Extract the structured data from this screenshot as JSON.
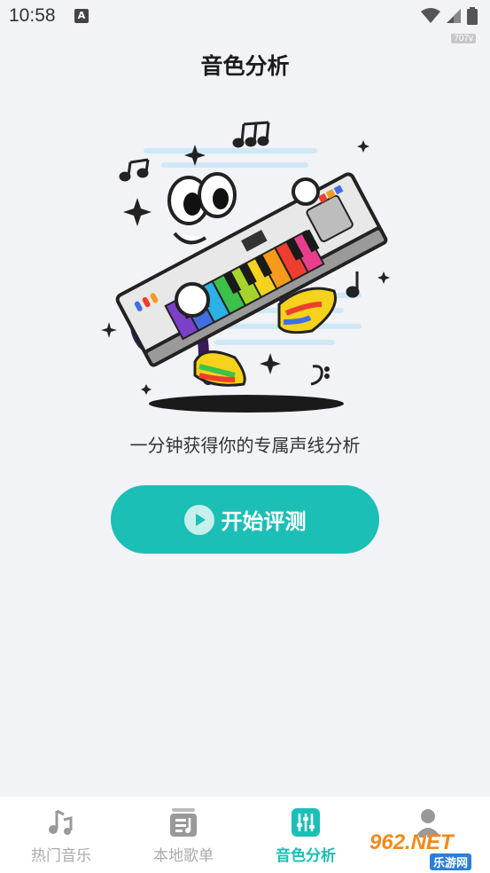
{
  "status_bar": {
    "time": "10:58",
    "notification_glyph": "A",
    "badge": "707v",
    "icons": [
      "wifi-icon",
      "signal-icon",
      "battery-icon"
    ]
  },
  "header": {
    "title": "音色分析"
  },
  "main": {
    "subtitle": "一分钟获得你的专属声线分析",
    "start_button_label": "开始评测"
  },
  "tab_bar": {
    "active_index": 2,
    "accent_color": "#1bbfb6",
    "items": [
      {
        "label": "热门音乐",
        "icon": "music-note-icon"
      },
      {
        "label": "本地歌单",
        "icon": "playlist-icon"
      },
      {
        "label": "音色分析",
        "icon": "equalizer-icon"
      },
      {
        "label": "",
        "icon": "profile-icon"
      }
    ]
  },
  "watermark": {
    "brand": "962.NET",
    "sub": "乐游网"
  }
}
